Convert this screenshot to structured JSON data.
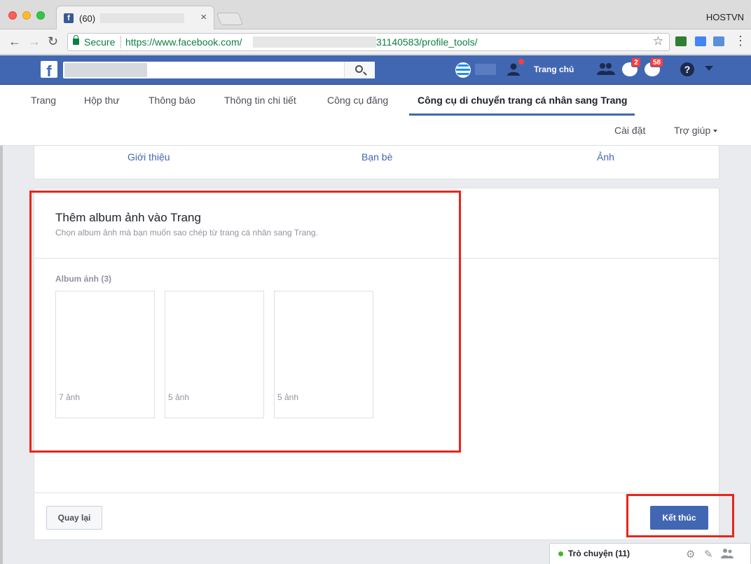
{
  "browser": {
    "tab_title": "(60)",
    "tab_close": "×",
    "profile": "HOSTVN",
    "secure_label": "Secure",
    "url_start": "https://www.facebook.com/",
    "url_end": "31140583/profile_tools/"
  },
  "fb_header": {
    "logo": "f",
    "home_label": "Trang chủ",
    "messages_badge": "2",
    "notifications_badge": "58",
    "help_glyph": "?"
  },
  "page_nav": {
    "items": [
      {
        "label": "Trang"
      },
      {
        "label": "Hộp thư"
      },
      {
        "label": "Thông báo"
      },
      {
        "label": "Thông tin chi tiết"
      },
      {
        "label": "Công cụ đăng"
      },
      {
        "label": "Công cụ di chuyển trang cá nhân sang Trang"
      }
    ],
    "settings": "Cài đặt",
    "help": "Trợ giúp"
  },
  "sub_tabs": {
    "intro": "Giới thiệu",
    "friends": "Bạn bè",
    "photos": "Ảnh"
  },
  "albums_section": {
    "title": "Thêm album ảnh vào Trang",
    "subtitle": "Chọn album ảnh mà bạn muốn sao chép từ trang cá nhân sang Trang.",
    "count_label": "Album ảnh (3)",
    "albums": [
      {
        "label": "7 ảnh"
      },
      {
        "label": "5 ảnh"
      },
      {
        "label": "5 ảnh"
      }
    ]
  },
  "footer": {
    "back_button": "Quay lại",
    "finish_button": "Kết thúc"
  },
  "chat": {
    "label": "Trò chuyện (11)"
  },
  "colors": {
    "fb_blue": "#4267b2",
    "highlight_red": "#e8251c",
    "online_green": "#42b72a"
  }
}
